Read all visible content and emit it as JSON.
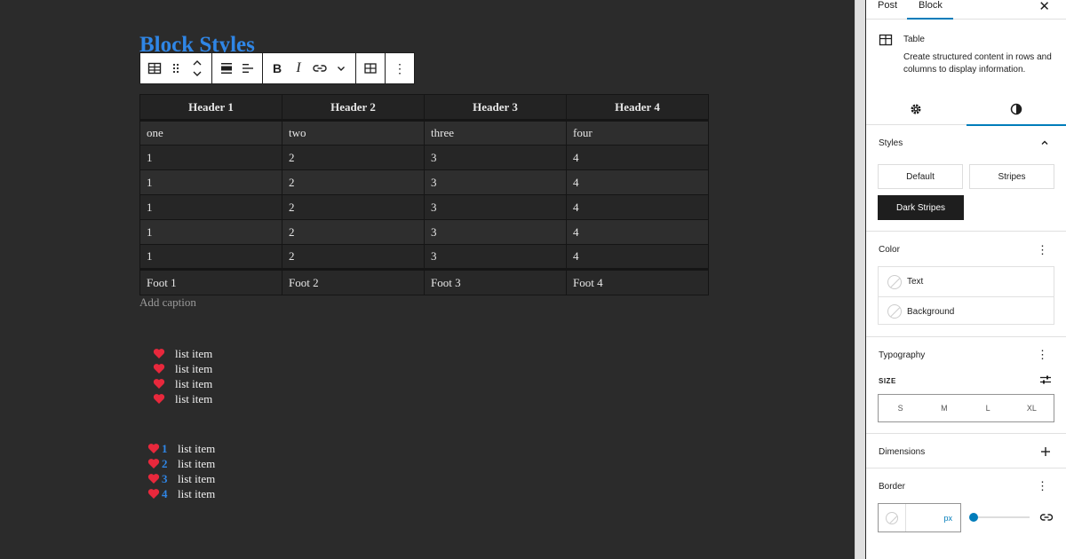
{
  "canvas": {
    "page_title": "Block Styles",
    "table": {
      "headers": [
        "Header 1",
        "Header 2",
        "Header 3",
        "Header 4"
      ],
      "rows": [
        [
          "one",
          "two",
          "three",
          "four"
        ],
        [
          "1",
          "2",
          "3",
          "4"
        ],
        [
          "1",
          "2",
          "3",
          "4"
        ],
        [
          "1",
          "2",
          "3",
          "4"
        ],
        [
          "1",
          "2",
          "3",
          "4"
        ],
        [
          "1",
          "2",
          "3",
          "4"
        ]
      ],
      "footer": [
        "Foot 1",
        "Foot 2",
        "Foot 3",
        "Foot 4"
      ],
      "caption_placeholder": "Add caption"
    },
    "bullet_list": [
      "list item",
      "list item",
      "list item",
      "list item"
    ],
    "numbered_list": [
      {
        "num": "1",
        "text": "list item"
      },
      {
        "num": "2",
        "text": "list item"
      },
      {
        "num": "3",
        "text": "list item"
      },
      {
        "num": "4",
        "text": "list item"
      }
    ],
    "colors": {
      "title": "#2f86e6",
      "heart": "#e8283c",
      "background": "#2b2b2b"
    }
  },
  "toolbar": {
    "icons": [
      "table-icon",
      "drag-handle-icon",
      "move-up-down-icon",
      "align-icon",
      "text-align-icon",
      "bold-icon",
      "italic-icon",
      "link-icon",
      "more-formats-icon",
      "edit-table-icon",
      "options-icon"
    ],
    "bold_label": "B",
    "italic_label": "I",
    "options_label": "⋮"
  },
  "sidebar": {
    "tabs": {
      "post": "Post",
      "block": "Block",
      "active": "Block"
    },
    "block": {
      "name": "Table",
      "description": "Create structured content in rows and columns to display information."
    },
    "styles": {
      "heading": "Styles",
      "options": [
        "Default",
        "Stripes",
        "Dark Stripes"
      ],
      "selected": "Dark Stripes"
    },
    "color": {
      "heading": "Color",
      "items": [
        "Text",
        "Background"
      ]
    },
    "typography": {
      "heading": "Typography",
      "size_label": "SIZE",
      "sizes": [
        "S",
        "M",
        "L",
        "XL"
      ]
    },
    "dimensions": {
      "heading": "Dimensions"
    },
    "border": {
      "heading": "Border",
      "unit": "px",
      "value": "",
      "slider": 0
    },
    "accent_color": "#007cba"
  }
}
